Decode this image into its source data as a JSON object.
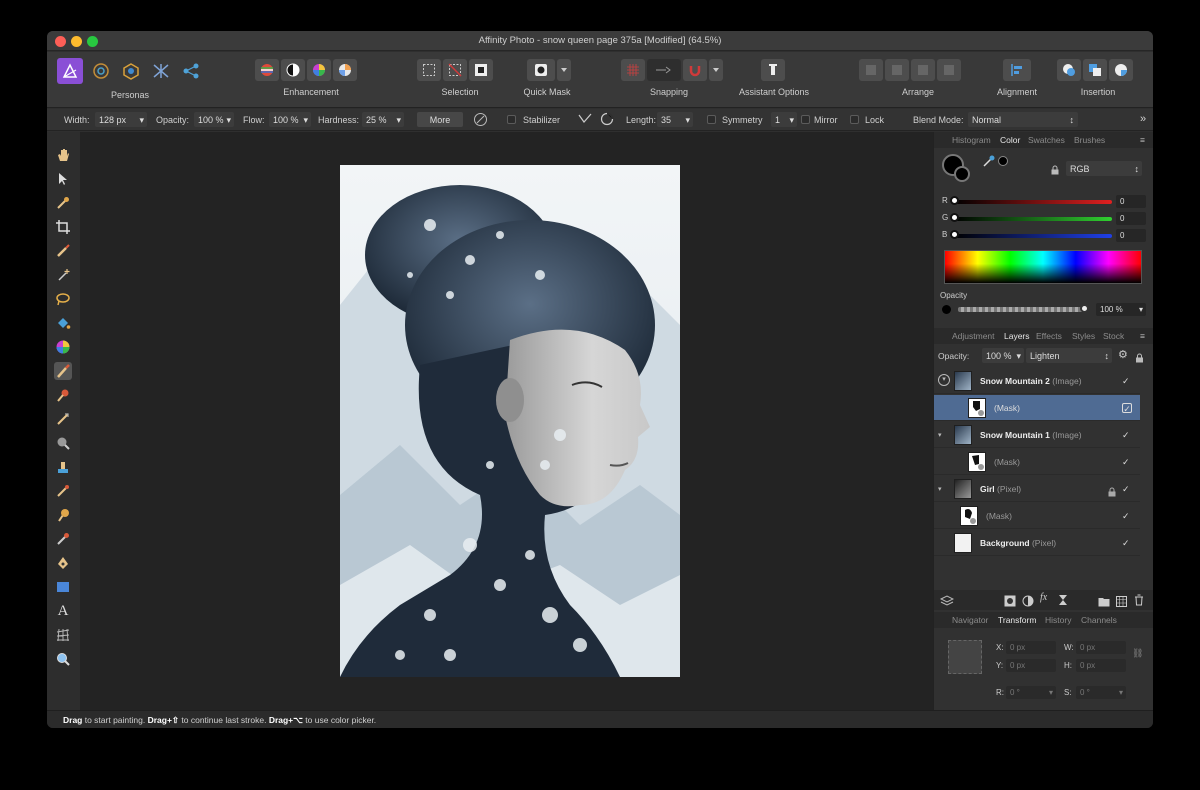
{
  "window": {
    "title": "Affinity Photo - snow queen page 375a [Modified] (64.5%)"
  },
  "toolbar": {
    "personas": "Personas",
    "enhancement": "Enhancement",
    "selection": "Selection",
    "quick_mask": "Quick Mask",
    "snapping": "Snapping",
    "assistant": "Assistant Options",
    "arrange": "Arrange",
    "alignment": "Alignment",
    "insertion": "Insertion"
  },
  "context": {
    "width_label": "Width:",
    "width_value": "128 px",
    "opacity_label": "Opacity:",
    "opacity_value": "100 %",
    "flow_label": "Flow:",
    "flow_value": "100 %",
    "hardness_label": "Hardness:",
    "hardness_value": "25 %",
    "more": "More",
    "stabilizer": "Stabilizer",
    "length_label": "Length:",
    "length_value": "35",
    "symmetry": "Symmetry",
    "symmetry_value": "1",
    "mirror": "Mirror",
    "lock": "Lock",
    "blend_label": "Blend Mode:",
    "blend_value": "Normal"
  },
  "color_panel": {
    "tabs": [
      "Histogram",
      "Color",
      "Swatches",
      "Brushes"
    ],
    "model": "RGB",
    "r_label": "R",
    "g_label": "G",
    "b_label": "B",
    "r": "0",
    "g": "0",
    "b": "0",
    "opacity_label": "Opacity",
    "opacity_value": "100 %"
  },
  "layers_panel": {
    "tabs": [
      "Adjustment",
      "Layers",
      "Effects",
      "Styles",
      "Stock"
    ],
    "opacity_label": "Opacity:",
    "opacity_value": "100 %",
    "blend": "Lighten",
    "layers": [
      {
        "name": "Snow Mountain 2",
        "type": "(Image)"
      },
      {
        "name": "(Mask)"
      },
      {
        "name": "Snow Mountain 1",
        "type": "(Image)"
      },
      {
        "name": "(Mask)"
      },
      {
        "name": "Girl",
        "type": "(Pixel)"
      },
      {
        "name": "(Mask)"
      },
      {
        "name": "Background",
        "type": "(Pixel)"
      }
    ]
  },
  "transform_panel": {
    "tabs": [
      "Navigator",
      "Transform",
      "History",
      "Channels"
    ],
    "x_label": "X:",
    "x": "0 px",
    "y_label": "Y:",
    "y": "0 px",
    "w_label": "W:",
    "w": "0 px",
    "h_label": "H:",
    "h": "0 px",
    "r_label": "R:",
    "r": "0 °",
    "s_label": "S:",
    "s": "0 °"
  },
  "status": {
    "b1": "Drag",
    "t1": " to start painting. ",
    "b2": "Drag+⇧",
    "t2": " to continue last stroke. ",
    "b3": "Drag+⌥",
    "t3": " to use color picker."
  }
}
